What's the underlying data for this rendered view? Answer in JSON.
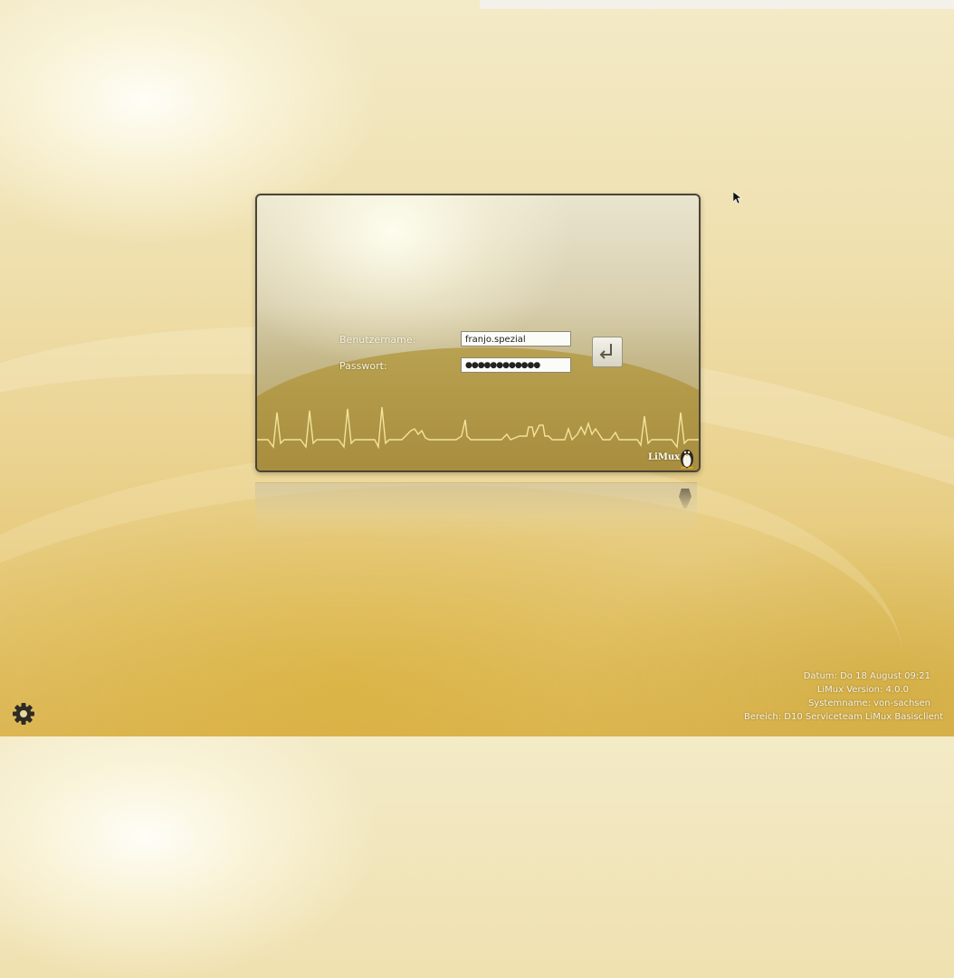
{
  "login": {
    "username_label": "Benutzername:",
    "username_value": "franjo.spezial",
    "password_label": "Passwort:",
    "password_value": "●●●●●●●●●●●●",
    "submit_icon": "enter-key-icon"
  },
  "branding": {
    "logo_text": "LiMux",
    "logo_icon": "tux-penguin-icon"
  },
  "system_info": {
    "datum": "Datum: Do 18 August 09:21",
    "version": "LiMux Version: 4.0.0",
    "systemname": "Systemname: von-sachsen",
    "bereich": "Bereich: D10 Serviceteam LiMux Basisclient"
  },
  "menu": {
    "icon": "gear-icon"
  },
  "colors": {
    "accent_gold": "#d4b04a",
    "dialog_border": "#4a4436",
    "text_light": "#f6f2dd"
  }
}
